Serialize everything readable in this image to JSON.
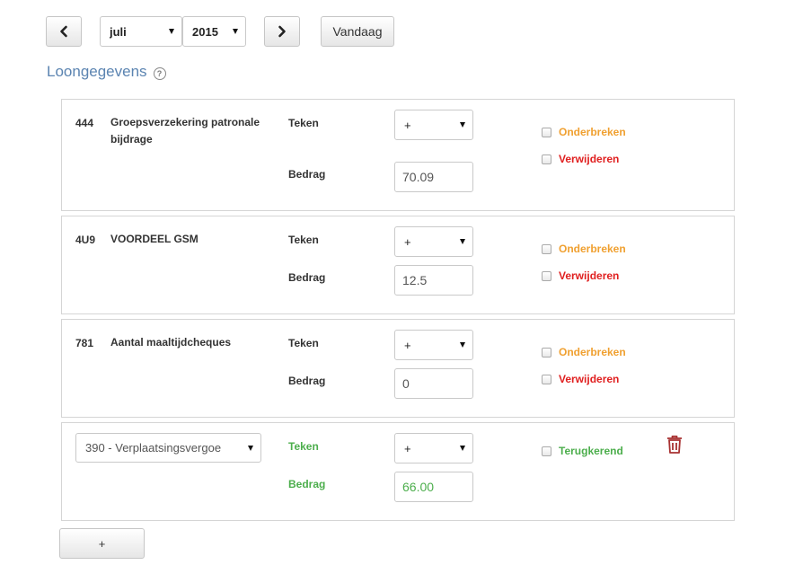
{
  "toolbar": {
    "prev_icon": "chevron-left-icon",
    "month": "juli",
    "year": "2015",
    "next_icon": "chevron-right-icon",
    "today_label": "Vandaag"
  },
  "section": {
    "title": "Loongegevens",
    "help_glyph": "?"
  },
  "rows": [
    {
      "code": "444",
      "description": "Groepsverzekering patronale bijdrage",
      "sign_label": "Teken",
      "sign_value": "+",
      "amount_label": "Bedrag",
      "amount_value": "70.09",
      "interrupt_label": "Onderbreken",
      "delete_label": "Verwijderen"
    },
    {
      "code": "4U9",
      "description": "VOORDEEL GSM",
      "sign_label": "Teken",
      "sign_value": "+",
      "amount_label": "Bedrag",
      "amount_value": "12.5",
      "interrupt_label": "Onderbreken",
      "delete_label": "Verwijderen"
    },
    {
      "code": "781",
      "description": "Aantal maaltijdcheques",
      "sign_label": "Teken",
      "sign_value": "+",
      "amount_label": "Bedrag",
      "amount_value": "0",
      "interrupt_label": "Onderbreken",
      "delete_label": "Verwijderen"
    }
  ],
  "new_row": {
    "code_select": "390 - Verplaatsingsvergoe",
    "sign_label": "Teken",
    "sign_value": "+",
    "amount_label": "Bedrag",
    "amount_value": "66.00",
    "recurring_label": "Terugkerend",
    "trash_icon": "trash-icon"
  },
  "add_button": "+",
  "colors": {
    "title": "#5b84b1",
    "interrupt": "#f0a030",
    "delete": "#e02020",
    "new_row_green": "#4cae4c",
    "trash": "#a83232"
  }
}
